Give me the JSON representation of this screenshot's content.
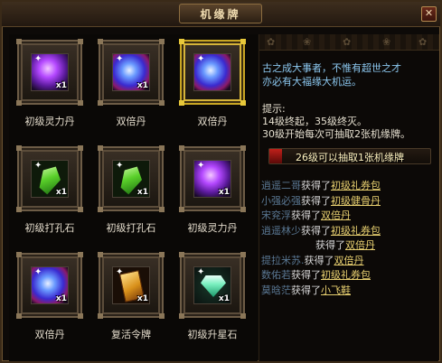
{
  "window": {
    "title": "机缘牌",
    "close_label": "✕"
  },
  "items": [
    {
      "name": "初级灵力丹",
      "qty": "x1",
      "icon": "purple-orb-icon",
      "highlight": false
    },
    {
      "name": "双倍丹",
      "qty": "x1",
      "icon": "blue-orb-icon",
      "highlight": false
    },
    {
      "name": "双倍丹",
      "qty": "",
      "icon": "blue-orb-icon",
      "highlight": true
    },
    {
      "name": "初级打孔石",
      "qty": "x1",
      "icon": "green-gem-icon",
      "highlight": false
    },
    {
      "name": "初级打孔石",
      "qty": "x1",
      "icon": "green-gem-icon",
      "highlight": false
    },
    {
      "name": "初级灵力丹",
      "qty": "x1",
      "icon": "purple-orb-icon",
      "highlight": false
    },
    {
      "name": "双倍丹",
      "qty": "x1",
      "icon": "blue-orb-icon",
      "highlight": false
    },
    {
      "name": "复活令牌",
      "qty": "x1",
      "icon": "gold-token-icon",
      "highlight": false
    },
    {
      "name": "初级升星石",
      "qty": "x1",
      "icon": "diamond-icon",
      "highlight": false
    }
  ],
  "info": {
    "intro_line1": "古之成大事者，不惟有超世之才",
    "intro_line2": "亦必有大福缘大机运。",
    "tips_title": "提示:",
    "tip1": "14级终起，35级终灭。",
    "tip2": "30级开始每次可抽取2张机缘牌。"
  },
  "progress": {
    "label": "26级可以抽取1张机缘牌",
    "fraction": 0.08
  },
  "log": [
    {
      "player": "逍遥二哥",
      "verb": "获得了",
      "item": "初级礼券包"
    },
    {
      "player": "小强必强",
      "verb": "获得了",
      "item": "初级健骨丹"
    },
    {
      "player": "宋兖浮",
      "verb": "获得了",
      "item": "双倍丹"
    },
    {
      "player": "逍遥林少",
      "verb": "获得了",
      "item": "初级礼券包"
    },
    {
      "player": "",
      "verb": "获得了",
      "item": "双倍丹"
    },
    {
      "player": "提拉米苏.",
      "verb": "获得了",
      "item": "双倍丹"
    },
    {
      "player": "数佑若",
      "verb": "获得了",
      "item": "初级礼券包"
    },
    {
      "player": "莫晗茫",
      "verb": "获得了",
      "item": "小飞鞋"
    }
  ]
}
